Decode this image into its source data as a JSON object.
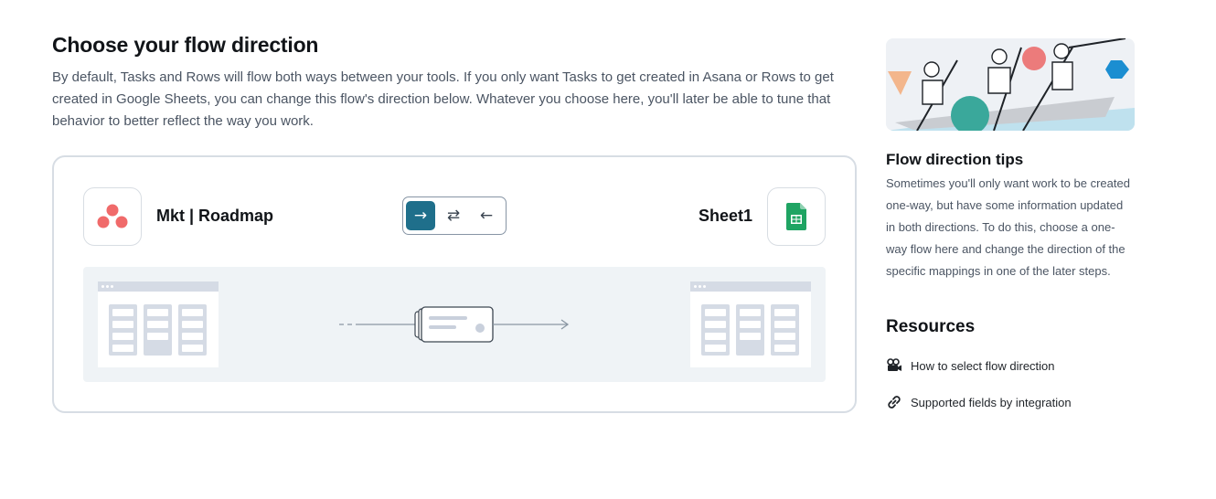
{
  "header": {
    "title": "Choose your flow direction",
    "description": "By default, Tasks and Rows will flow both ways between your tools. If you only want Tasks to get created in Asana or Rows to get created in Google Sheets, you can change this flow's direction below. Whatever you choose here, you'll later be able to tune that behavior to better reflect the way you work."
  },
  "flow": {
    "left_tool": {
      "name": "Mkt | Roadmap",
      "icon": "asana-logo-icon"
    },
    "right_tool": {
      "name": "Sheet1",
      "icon": "google-sheets-logo-icon"
    },
    "direction_options": [
      {
        "glyph": "→",
        "name": "one-way-to-right",
        "selected": true
      },
      {
        "glyph": "⇄",
        "name": "two-way",
        "selected": false
      },
      {
        "glyph": "←",
        "name": "one-way-to-left",
        "selected": false
      }
    ]
  },
  "sidebar": {
    "tips_title": "Flow direction tips",
    "tips_text": "Sometimes you'll only want work to be created one-way, but have some information updated in both directions. To do this, choose a one-way flow here and change the direction of the specific mappings in one of the later steps.",
    "resources_title": "Resources",
    "resources": [
      {
        "label": "How to select flow direction",
        "icon": "video-camera-icon"
      },
      {
        "label": "Supported fields by integration",
        "icon": "link-icon"
      }
    ]
  },
  "colors": {
    "accent": "#1f6f8b",
    "asana": "#f06a6a",
    "sheets": "#1fa463",
    "border": "#d7dde4"
  }
}
